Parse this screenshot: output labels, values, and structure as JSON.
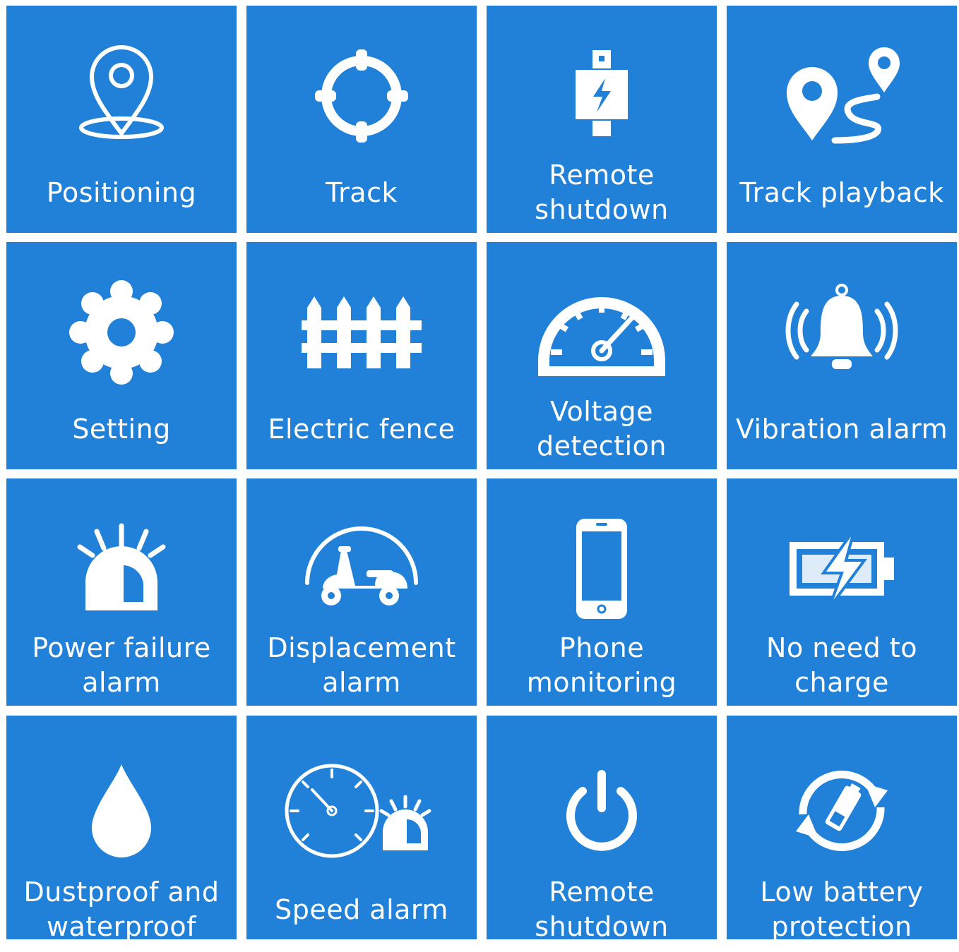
{
  "colors": {
    "tile": "#2180d7",
    "icon": "#ffffff",
    "background": "#ffffff"
  },
  "features": [
    {
      "label": "Positioning",
      "icon": "location-pin-icon"
    },
    {
      "label": "Track",
      "icon": "crosshair-icon"
    },
    {
      "label": "Remote\nshutdown",
      "icon": "relay-lightning-icon"
    },
    {
      "label": "Track playback",
      "icon": "route-pins-icon"
    },
    {
      "label": "Setting",
      "icon": "gear-icon"
    },
    {
      "label": "Electric fence",
      "icon": "fence-icon"
    },
    {
      "label": "Voltage\ndetection",
      "icon": "gauge-icon"
    },
    {
      "label": "Vibration alarm",
      "icon": "ringing-bell-icon"
    },
    {
      "label": "Power failure\nalarm",
      "icon": "siren-icon"
    },
    {
      "label": "Displacement\nalarm",
      "icon": "scooter-icon"
    },
    {
      "label": "Phone\nmonitoring",
      "icon": "smartphone-icon"
    },
    {
      "label": "No need to\ncharge",
      "icon": "battery-bolt-icon"
    },
    {
      "label": "Dustproof and\nwaterproof",
      "icon": "water-drop-icon"
    },
    {
      "label": "Speed alarm",
      "icon": "speedometer-siren-icon"
    },
    {
      "label": "Remote\nshutdown",
      "icon": "power-icon"
    },
    {
      "label": "Low battery\nprotection",
      "icon": "battery-cycle-icon"
    }
  ]
}
